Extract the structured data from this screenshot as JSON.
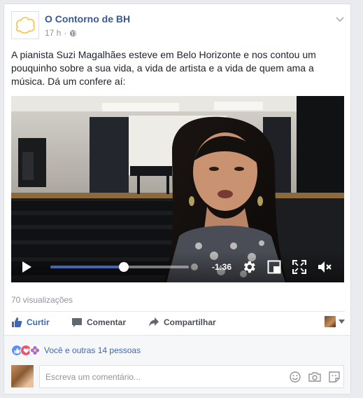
{
  "post": {
    "page_name": "O Contorno de BH",
    "time": "17 h",
    "separator": "·",
    "text": "A pianista Suzi Magalhães esteve em Belo Horizonte e nos contou um pouquinho sobre a sua vida, a vida de artista e a vida de quem ama a música. Dá um confere aí:"
  },
  "video": {
    "remaining_time": "-1:36",
    "progress": 0.53
  },
  "stats": {
    "views": "70 visualizações"
  },
  "actions": {
    "like": "Curtir",
    "comment": "Comentar",
    "share": "Compartilhar"
  },
  "reactions": {
    "summary": "Você e outras 14 pessoas"
  },
  "comment": {
    "placeholder": "Escreva um comentário..."
  },
  "colors": {
    "link": "#365899",
    "accent": "#4267b2",
    "like_reaction": "#5890ff",
    "love_reaction": "#f25268",
    "flower_reaction": "#a66bd6"
  }
}
